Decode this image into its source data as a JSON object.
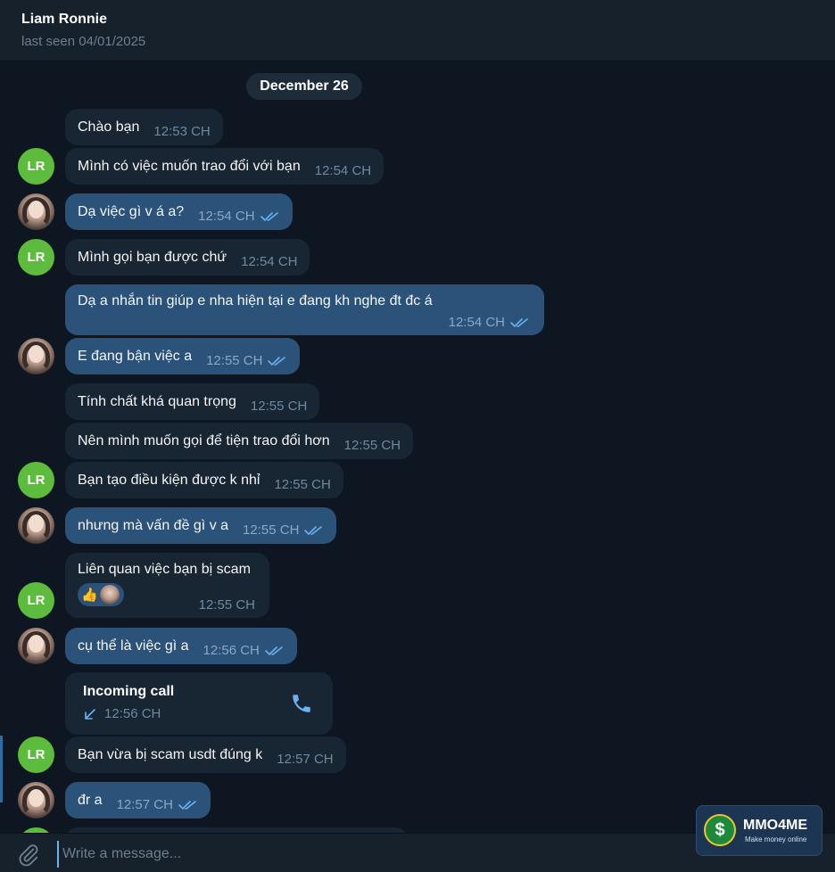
{
  "header": {
    "name": "Liam Ronnie",
    "status": "last seen 04/01/2025"
  },
  "chat": {
    "date": "December 26",
    "messages": [
      {
        "dir": "in",
        "text": "Chào bạn",
        "time": "12:53 CH",
        "avatar": ""
      },
      {
        "dir": "in",
        "text": "Mình có việc muốn trao đổi với bạn",
        "time": "12:54 CH",
        "avatar": "LR"
      },
      {
        "dir": "out",
        "text": "Dạ việc gì v á a?",
        "time": "12:54 CH"
      },
      {
        "dir": "in",
        "text": "Mình gọi bạn được chứ",
        "time": "12:54 CH",
        "avatar": "LR"
      },
      {
        "dir": "out",
        "text": "Dạ a nhắn tin giúp e nha hiện tại e đang kh nghe đt đc á",
        "time": "12:54 CH"
      },
      {
        "dir": "out",
        "text": "E đang bận việc a",
        "time": "12:55 CH"
      },
      {
        "dir": "in",
        "text": "Tính chất khá quan trọng",
        "time": "12:55 CH"
      },
      {
        "dir": "in",
        "text": "Nên mình muốn gọi để tiện trao đổi hơn",
        "time": "12:55 CH"
      },
      {
        "dir": "in",
        "text": "Bạn tạo điều kiện được k nhỉ",
        "time": "12:55 CH",
        "avatar": "LR"
      },
      {
        "dir": "out",
        "text": "nhưng mà vấn đề gì v a",
        "time": "12:55 CH"
      },
      {
        "dir": "in",
        "text": "Liên quan việc bạn bị scam",
        "time": "12:55 CH",
        "avatar": "LR",
        "reaction": "👍"
      },
      {
        "dir": "out",
        "text": "cụ thể là việc gì a",
        "time": "12:56 CH"
      },
      {
        "dir": "in",
        "text": "Bạn vừa bị scam usdt đúng k",
        "time": "12:57 CH",
        "avatar": "LR"
      },
      {
        "dir": "out",
        "text": "đr a",
        "time": "12:57 CH"
      }
    ],
    "call": {
      "title": "Incoming call",
      "time": "12:56 CH"
    }
  },
  "composer": {
    "placeholder": "Write a message..."
  },
  "watermark": {
    "name": "MMO4ME",
    "tagline": "Make money online",
    "symbol": "$"
  },
  "colors": {
    "background": "#0e1621",
    "incoming": "#182533",
    "outgoing": "#2b5278",
    "accent": "#6ab2f2",
    "avatar_green": "#5dbb3e"
  }
}
